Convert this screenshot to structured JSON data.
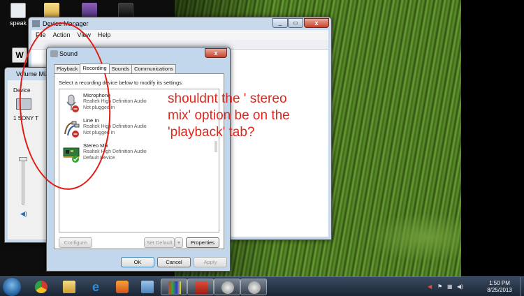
{
  "desktop": {
    "icons": [
      {
        "label": "speak"
      },
      {
        "label": "W"
      },
      {
        "label": ""
      },
      {
        "label": ""
      }
    ]
  },
  "device_manager": {
    "title": "Device Manager",
    "menu": [
      "File",
      "Action",
      "View",
      "Help"
    ]
  },
  "volume_mixer": {
    "title": "Volume Mix",
    "device_label": "Device",
    "device_name": "SONY T"
  },
  "sound_dialog": {
    "title": "Sound",
    "close": "x",
    "tabs": [
      "Playback",
      "Recording",
      "Sounds",
      "Communications"
    ],
    "active_tab": "Recording",
    "hint": "Select a recording device below to modify its settings:",
    "devices": [
      {
        "name": "Microphone",
        "driver": "Realtek High Definition Audio",
        "status": "Not plugged in",
        "icon": "microphone-icon"
      },
      {
        "name": "Line In",
        "driver": "Realtek High Definition Audio",
        "status": "Not plugged in",
        "icon": "line-in-icon"
      },
      {
        "name": "Stereo Mix",
        "driver": "Realtek High Definition Audio",
        "status": "Default Device",
        "icon": "sound-card-icon"
      }
    ],
    "buttons": {
      "configure": "Configure",
      "set_default": "Set Default",
      "properties": "Properties",
      "ok": "OK",
      "cancel": "Cancel",
      "apply": "Apply"
    }
  },
  "annotation": {
    "text": "shouldnt the ' stereo mix' option be on the 'playback' tab?",
    "color": "#e0261b"
  },
  "taskbar": {
    "apps": [
      "chrome-icon",
      "explorer-icon",
      "ie-icon",
      "media-player-icon",
      "control-panel-icon",
      "paint-icon",
      "toolbox-icon",
      "speaker-icon",
      "speaker-icon"
    ],
    "time": "1:50 PM",
    "date": "8/25/2013"
  }
}
